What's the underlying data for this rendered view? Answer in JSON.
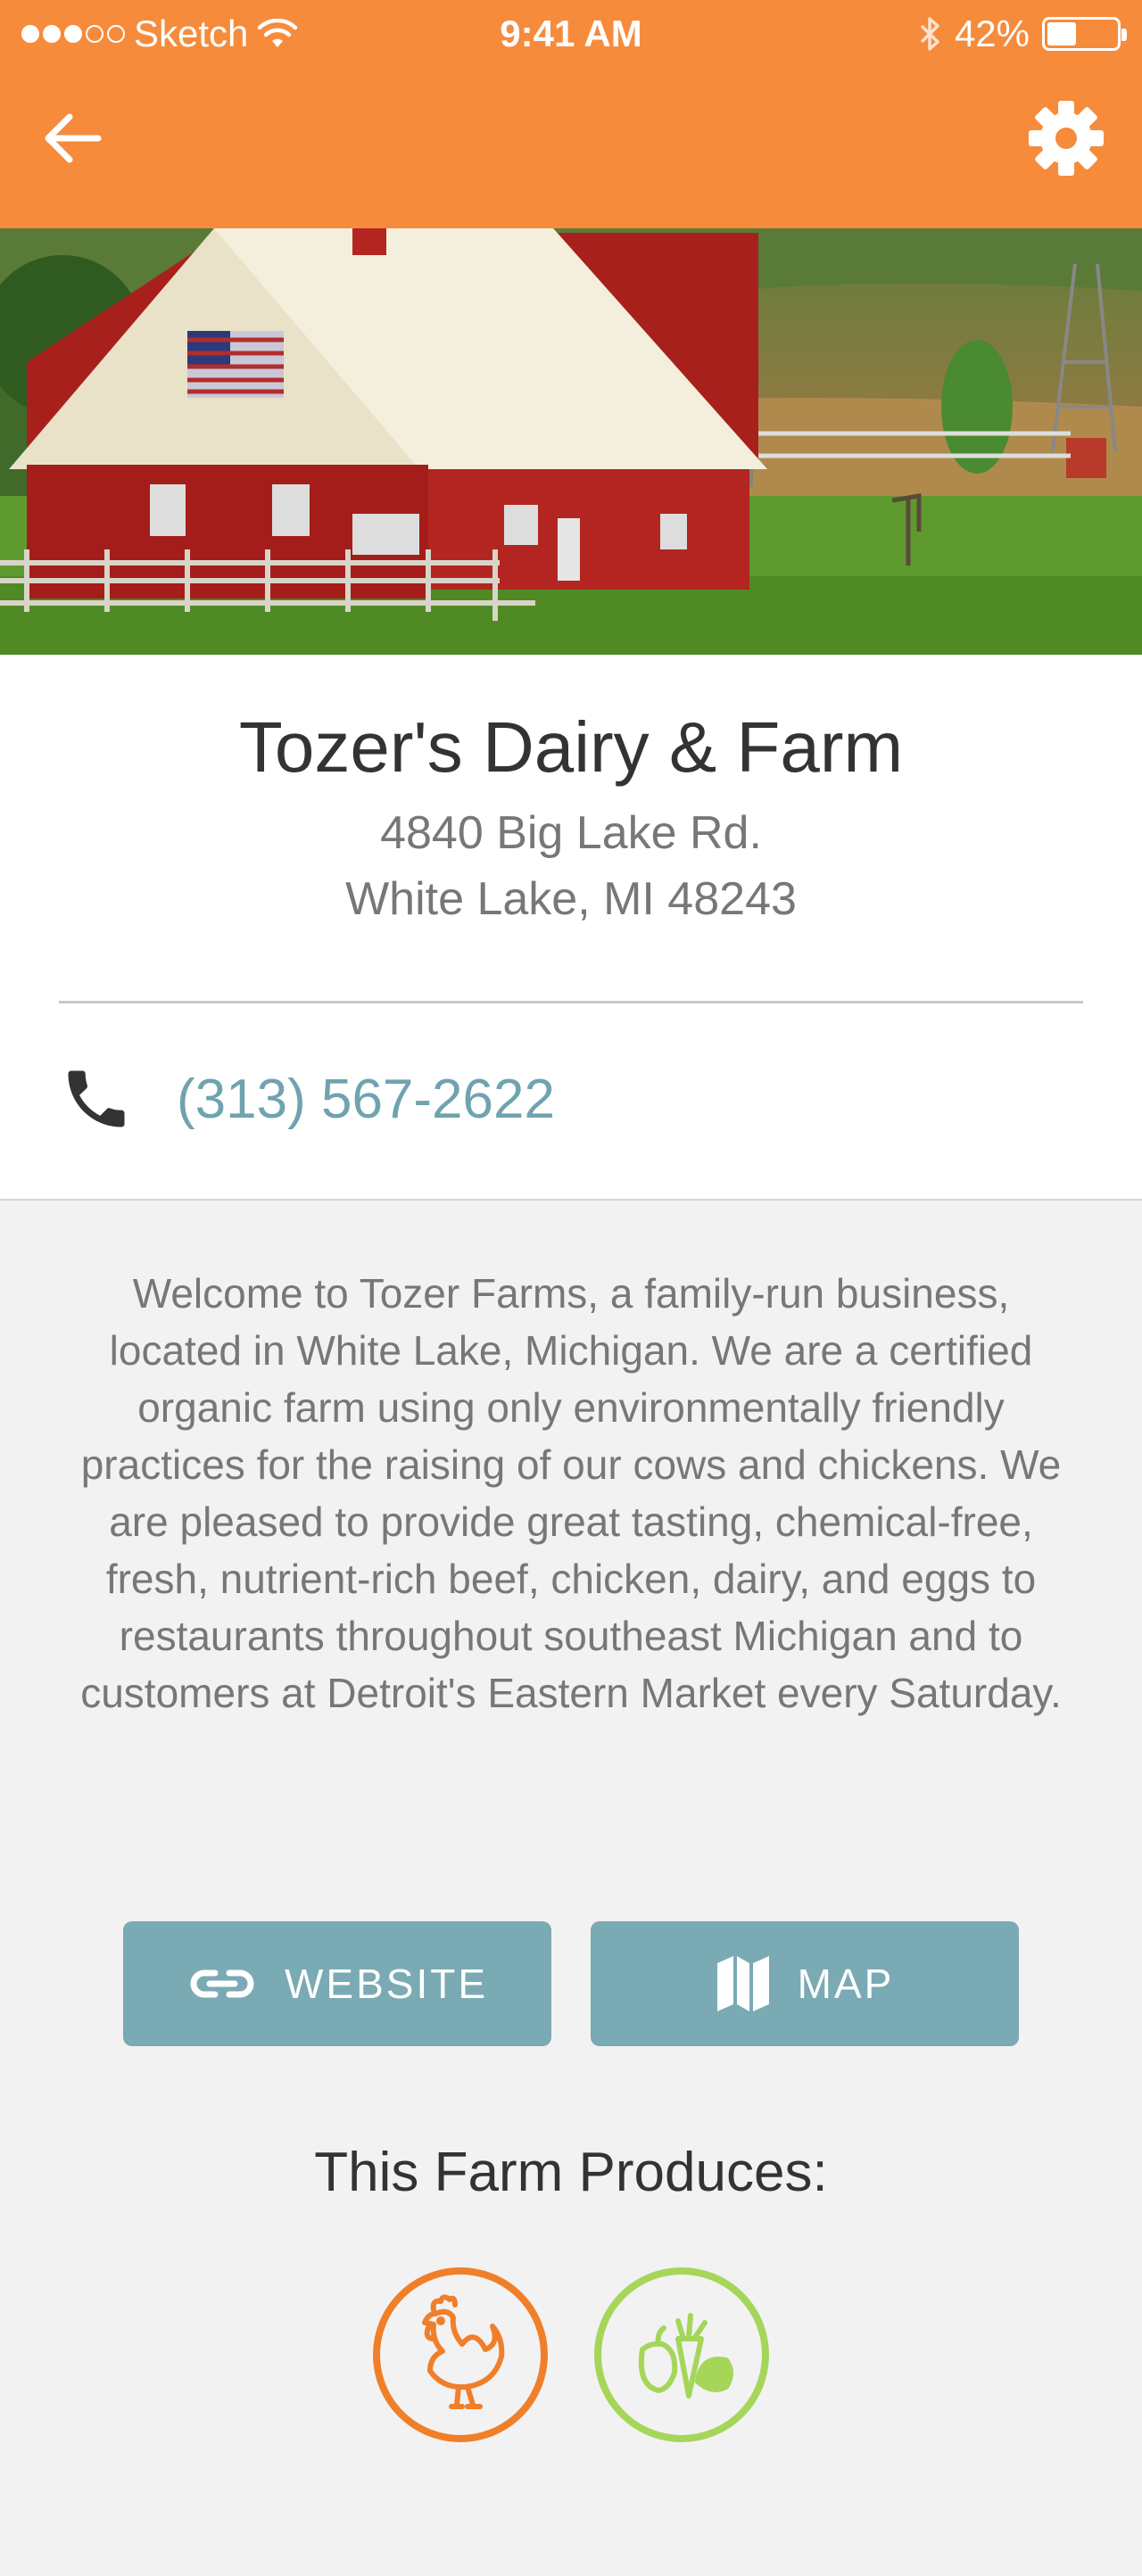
{
  "status_bar": {
    "carrier": "Sketch",
    "time": "9:41 AM",
    "battery": "42%",
    "battery_level": 0.42,
    "signal_bars_filled": 3
  },
  "header": {
    "back_icon": "back-arrow-icon",
    "settings_icon": "gear-icon",
    "background_color": "#f68b3c"
  },
  "farm": {
    "name": "Tozer's Dairy & Farm",
    "address_line1": "4840 Big Lake Rd.",
    "address_line2": "White Lake, MI 48243",
    "phone": "(313) 567-2622",
    "description": "Welcome to Tozer Farms, a family-run business, located in White Lake, Michigan. We are a certified organic farm using only environmentally friendly practices for the raising of our cows and chickens. We are pleased to provide great tasting, chemical-free, fresh, nutrient-rich beef, chicken, dairy, and eggs to restaurants throughout southeast Michigan and to customers at Detroit's Eastern Market every Saturday."
  },
  "actions": {
    "website_label": "WEBSITE",
    "map_label": "MAP",
    "button_color": "#7aaab4"
  },
  "produces": {
    "heading": "This Farm Produces:",
    "items": [
      {
        "icon": "chicken-icon",
        "color": "#f07f2a"
      },
      {
        "icon": "produce-icon",
        "color": "#a5d65a"
      }
    ]
  }
}
